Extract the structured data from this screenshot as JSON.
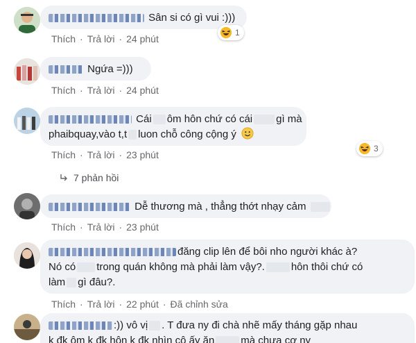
{
  "comments": [
    {
      "text": "Sân si có gì vui :)))",
      "action_like": "Thích",
      "action_reply": "Trả lời",
      "time": "24 phút",
      "reaction_count": "1",
      "reaction_icon": "haha-emoji-icon"
    },
    {
      "text": "Ngứa =)))",
      "action_like": "Thích",
      "action_reply": "Trả lời",
      "time": "24 phút"
    },
    {
      "text_part1": "Cái",
      "text_part2": "ôm hôn chứ có cái",
      "text_part3": "gì mà",
      "text_part4": "phaibquay,vào t,t",
      "text_part5": "luon chỗ công cộng ý",
      "action_like": "Thích",
      "action_reply": "Trả lời",
      "time": "23 phút",
      "reaction_count": "3",
      "reaction_icon": "haha-emoji-icon",
      "replies_label": "7 phản hồi"
    },
    {
      "text": "Dễ thương mà , thẳng thớt nhạy cảm",
      "action_like": "Thích",
      "action_reply": "Trả lời",
      "time": "23 phút"
    },
    {
      "text_part1": "đăng clip lên để bôi nho người khác à?",
      "text_part2": "Nó có",
      "text_part3": "trong quán không mà phải làm vậy?.",
      "text_part4": "hôn thôi chứ có",
      "text_part5": "làm",
      "text_part6": "gì đâu?.",
      "action_like": "Thích",
      "action_reply": "Trả lời",
      "time": "22 phút",
      "edited": "Đã chỉnh sửa"
    },
    {
      "text_part1": ":)) vô vị",
      "text_part2": ". T đưa ny đi chà nhẽ mấy tháng gặp nhau",
      "text_part3": "k đk ôm k đk hôn k đk nhìn cô ấy ăn",
      "text_part4": "mà chưa cơ ny"
    }
  ],
  "colors": {
    "bubble": "#f0f2f5",
    "action_text": "#65676b",
    "reaction_yellow": "#f7b928"
  }
}
